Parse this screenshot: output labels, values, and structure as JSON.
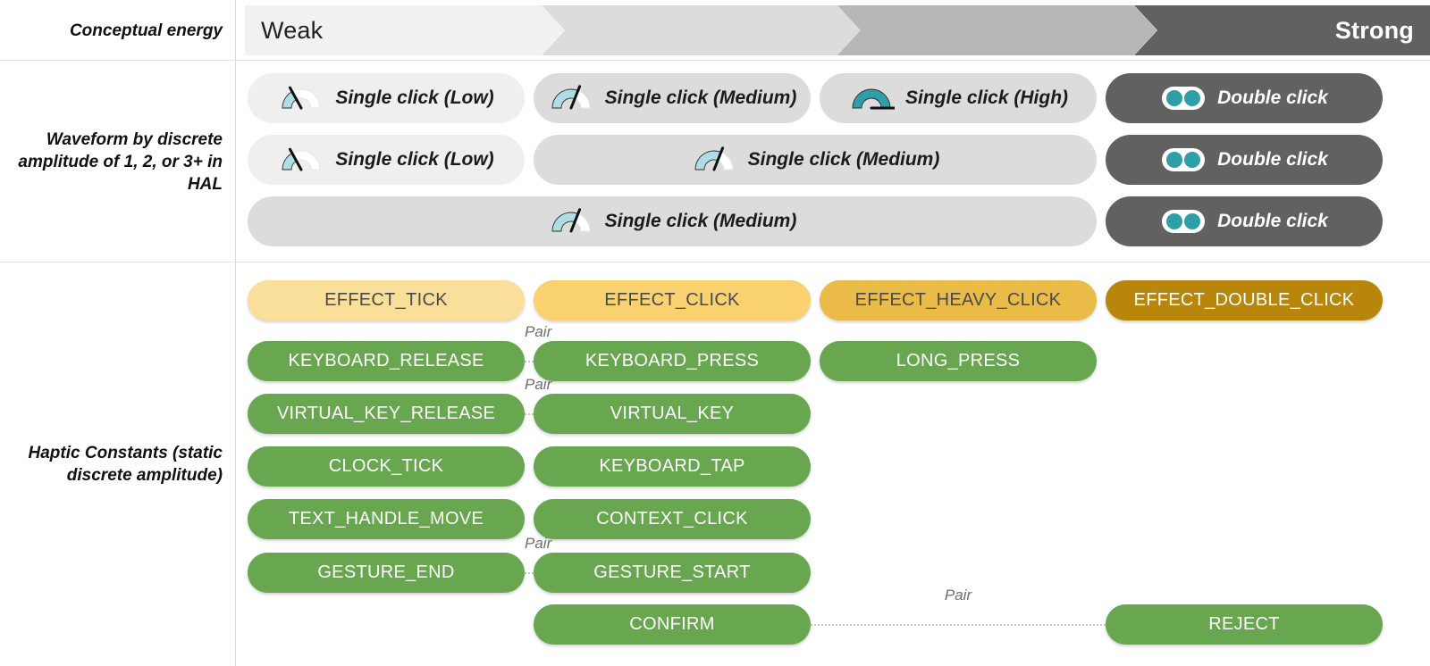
{
  "colors": {
    "chevron_1": "#F1F1F1",
    "chevron_2": "#DCDCDC",
    "chevron_3": "#B7B7B7",
    "chevron_4": "#616161",
    "chip_light": "#EFEFEF",
    "chip_mid": "#DCDCDC",
    "chip_dark": "#616161",
    "gauge_teal": "#2E9EA8",
    "gauge_light": "#AEDDE6",
    "pill_green": "#68A750",
    "pill_yellow_tick": "#FADF9B",
    "pill_yellow_click": "#F9D16E",
    "pill_yellow_heavy": "#EBBB48",
    "pill_gold_double": "#B8860B"
  },
  "energy": {
    "label": "Conceptual energy",
    "steps": [
      {
        "text": "Weak",
        "align": "left",
        "color": "#F1F1F1",
        "text_color": "#202124"
      },
      {
        "text": "",
        "align": "left",
        "color": "#DCDCDC",
        "text_color": "#202124"
      },
      {
        "text": "",
        "align": "left",
        "color": "#B7B7B7",
        "text_color": "#202124"
      },
      {
        "text": "Strong",
        "align": "right",
        "color": "#616161",
        "text_color": "#ffffff"
      }
    ]
  },
  "waveform": {
    "label": "Waveform by discrete amplitude of 1, 2, or 3+ in HAL",
    "rows": [
      {
        "chips": [
          {
            "text": "Single click (Low)",
            "icon": "gauge-low-icon",
            "tone": "light",
            "col": 1,
            "span": 1
          },
          {
            "text": "Single click (Medium)",
            "icon": "gauge-medium-icon",
            "tone": "mid",
            "col": 2,
            "span": 1
          },
          {
            "text": "Single click (High)",
            "icon": "gauge-high-icon",
            "tone": "mid",
            "col": 3,
            "span": 1
          },
          {
            "text": "Double click",
            "icon": "double-dot-icon",
            "tone": "dark",
            "col": 4,
            "span": 1
          }
        ]
      },
      {
        "chips": [
          {
            "text": "Single click (Low)",
            "icon": "gauge-low-icon",
            "tone": "light",
            "col": 1,
            "span": 1
          },
          {
            "text": "Single click (Medium)",
            "icon": "gauge-medium-icon",
            "tone": "mid",
            "col": 2,
            "span": 2
          },
          {
            "text": "Double click",
            "icon": "double-dot-icon",
            "tone": "dark",
            "col": 4,
            "span": 1
          }
        ]
      },
      {
        "chips": [
          {
            "text": "Single click (Medium)",
            "icon": "gauge-medium-icon",
            "tone": "mid",
            "col": 1,
            "span": 3
          },
          {
            "text": "Double click",
            "icon": "double-dot-icon",
            "tone": "dark",
            "col": 4,
            "span": 1
          }
        ]
      }
    ]
  },
  "constants": {
    "label": "Haptic Constants (static discrete amplitude)",
    "pair_label": "Pair",
    "rows": [
      {
        "pills": [
          {
            "text": "EFFECT_TICK",
            "style": "ylo",
            "col": 1
          },
          {
            "text": "EFFECT_CLICK",
            "style": "ymd",
            "col": 2
          },
          {
            "text": "EFFECT_HEAVY_CLICK",
            "style": "yhi",
            "col": 3
          },
          {
            "text": "EFFECT_DOUBLE_CLICK",
            "style": "ydk",
            "col": 4
          }
        ],
        "pairs": []
      },
      {
        "pills": [
          {
            "text": "KEYBOARD_RELEASE",
            "style": "grn",
            "col": 1
          },
          {
            "text": "KEYBOARD_PRESS",
            "style": "grn",
            "col": 2
          },
          {
            "text": "LONG_PRESS",
            "style": "grn",
            "col": 3
          }
        ],
        "pairs": [
          {
            "from": 1,
            "to": 2
          }
        ]
      },
      {
        "pills": [
          {
            "text": "VIRTUAL_KEY_RELEASE",
            "style": "grn",
            "col": 1
          },
          {
            "text": "VIRTUAL_KEY",
            "style": "grn",
            "col": 2
          }
        ],
        "pairs": [
          {
            "from": 1,
            "to": 2
          }
        ]
      },
      {
        "pills": [
          {
            "text": "CLOCK_TICK",
            "style": "grn",
            "col": 1
          },
          {
            "text": "KEYBOARD_TAP",
            "style": "grn",
            "col": 2
          }
        ],
        "pairs": []
      },
      {
        "pills": [
          {
            "text": "TEXT_HANDLE_MOVE",
            "style": "grn",
            "col": 1
          },
          {
            "text": "CONTEXT_CLICK",
            "style": "grn",
            "col": 2
          }
        ],
        "pairs": []
      },
      {
        "pills": [
          {
            "text": "GESTURE_END",
            "style": "grn",
            "col": 1
          },
          {
            "text": "GESTURE_START",
            "style": "grn",
            "col": 2
          }
        ],
        "pairs": [
          {
            "from": 1,
            "to": 2
          }
        ]
      },
      {
        "pills": [
          {
            "text": "CONFIRM",
            "style": "grn",
            "col": 2
          },
          {
            "text": "REJECT",
            "style": "grn",
            "col": 4
          }
        ],
        "pairs": [
          {
            "from": 2,
            "to": 4
          }
        ]
      }
    ]
  }
}
